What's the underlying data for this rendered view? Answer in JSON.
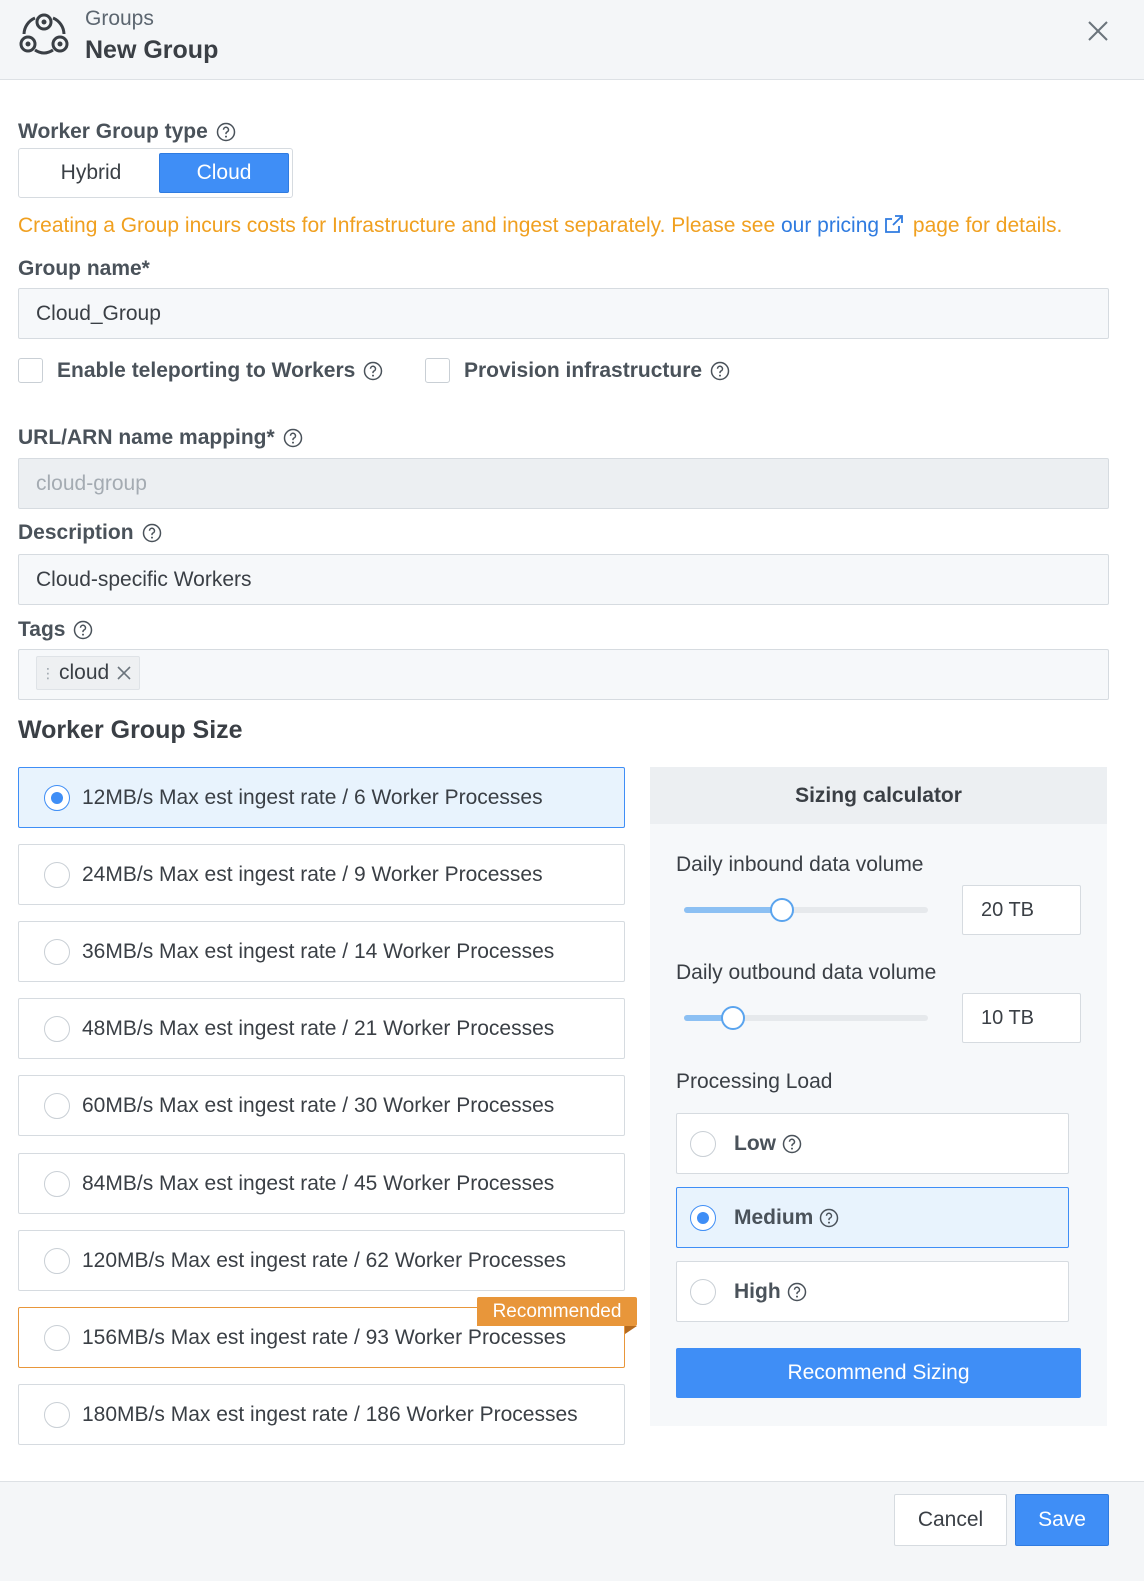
{
  "header": {
    "breadcrumb": "Groups",
    "title": "New Group"
  },
  "worker_group_type": {
    "label": "Worker Group type",
    "options": [
      "Hybrid",
      "Cloud"
    ],
    "selected": "Cloud"
  },
  "notice": {
    "before": "Creating a Group incurs costs for Infrastructure and ingest separately. Please see ",
    "link": "our pricing",
    "after": " page for details."
  },
  "group_name": {
    "label": "Group name*",
    "value": "Cloud_Group"
  },
  "checkboxes": {
    "teleport": "Enable teleporting to Workers",
    "provision": "Provision infrastructure"
  },
  "url_mapping": {
    "label": "URL/ARN name mapping*",
    "value": "cloud-group"
  },
  "description": {
    "label": "Description",
    "value": "Cloud-specific Workers"
  },
  "tags": {
    "label": "Tags",
    "items": [
      "cloud"
    ]
  },
  "size": {
    "title": "Worker Group Size",
    "options": [
      "12MB/s Max est ingest rate / 6 Worker Processes",
      "24MB/s Max est ingest rate / 9 Worker Processes",
      "36MB/s Max est ingest rate / 14 Worker Processes",
      "48MB/s Max est ingest rate / 21 Worker Processes",
      "60MB/s Max est ingest rate / 30 Worker Processes",
      "84MB/s Max est ingest rate / 45 Worker Processes",
      "120MB/s Max est ingest rate / 62 Worker Processes",
      "156MB/s Max est ingest rate / 93 Worker Processes",
      "180MB/s Max est ingest rate / 186 Worker Processes"
    ],
    "selected_index": 0,
    "recommended_index": 7,
    "recommended_label": "Recommended"
  },
  "calculator": {
    "title": "Sizing calculator",
    "inbound": {
      "label": "Daily inbound data volume",
      "value": "20 TB",
      "slider_fraction": 0.4
    },
    "outbound": {
      "label": "Daily outbound data volume",
      "value": "10 TB",
      "slider_fraction": 0.2
    },
    "processing_load": {
      "label": "Processing Load",
      "options": [
        "Low",
        "Medium",
        "High"
      ],
      "selected": "Medium"
    },
    "button": "Recommend Sizing"
  },
  "footer": {
    "cancel": "Cancel",
    "save": "Save"
  },
  "colors": {
    "accent": "#3f8ef6",
    "warning": "#f0a020",
    "recommended": "#e8963a"
  }
}
